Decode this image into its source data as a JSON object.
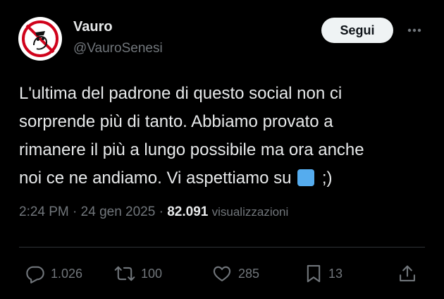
{
  "author": {
    "name": "Vauro",
    "handle": "@VauroSenesi"
  },
  "follow_label": "Segui",
  "tweet": {
    "lines": [
      "L'ultima del padrone di questo social non ci",
      "sorprende più di tanto. Abbiamo provato a",
      "rimanere il più a lungo possibile ma ora anche",
      "noi ce ne andiamo. Vi aspettiamo su",
      ";)"
    ]
  },
  "meta": {
    "time": "2:24 PM",
    "separator": "·",
    "date": "24 gen 2025",
    "views_count": "82.091",
    "views_label": "visualizzazioni"
  },
  "actions": {
    "replies": "1.026",
    "reposts": "100",
    "likes": "285",
    "bookmarks": "13"
  },
  "colors": {
    "background": "#000000",
    "text": "#e7e9ea",
    "secondary": "#71767b",
    "button_bg": "#eff3f4",
    "bluesky_square": "#55acee"
  },
  "icons": [
    "reply-icon",
    "repost-icon",
    "like-icon",
    "bookmark-icon",
    "share-icon",
    "more-icon"
  ]
}
